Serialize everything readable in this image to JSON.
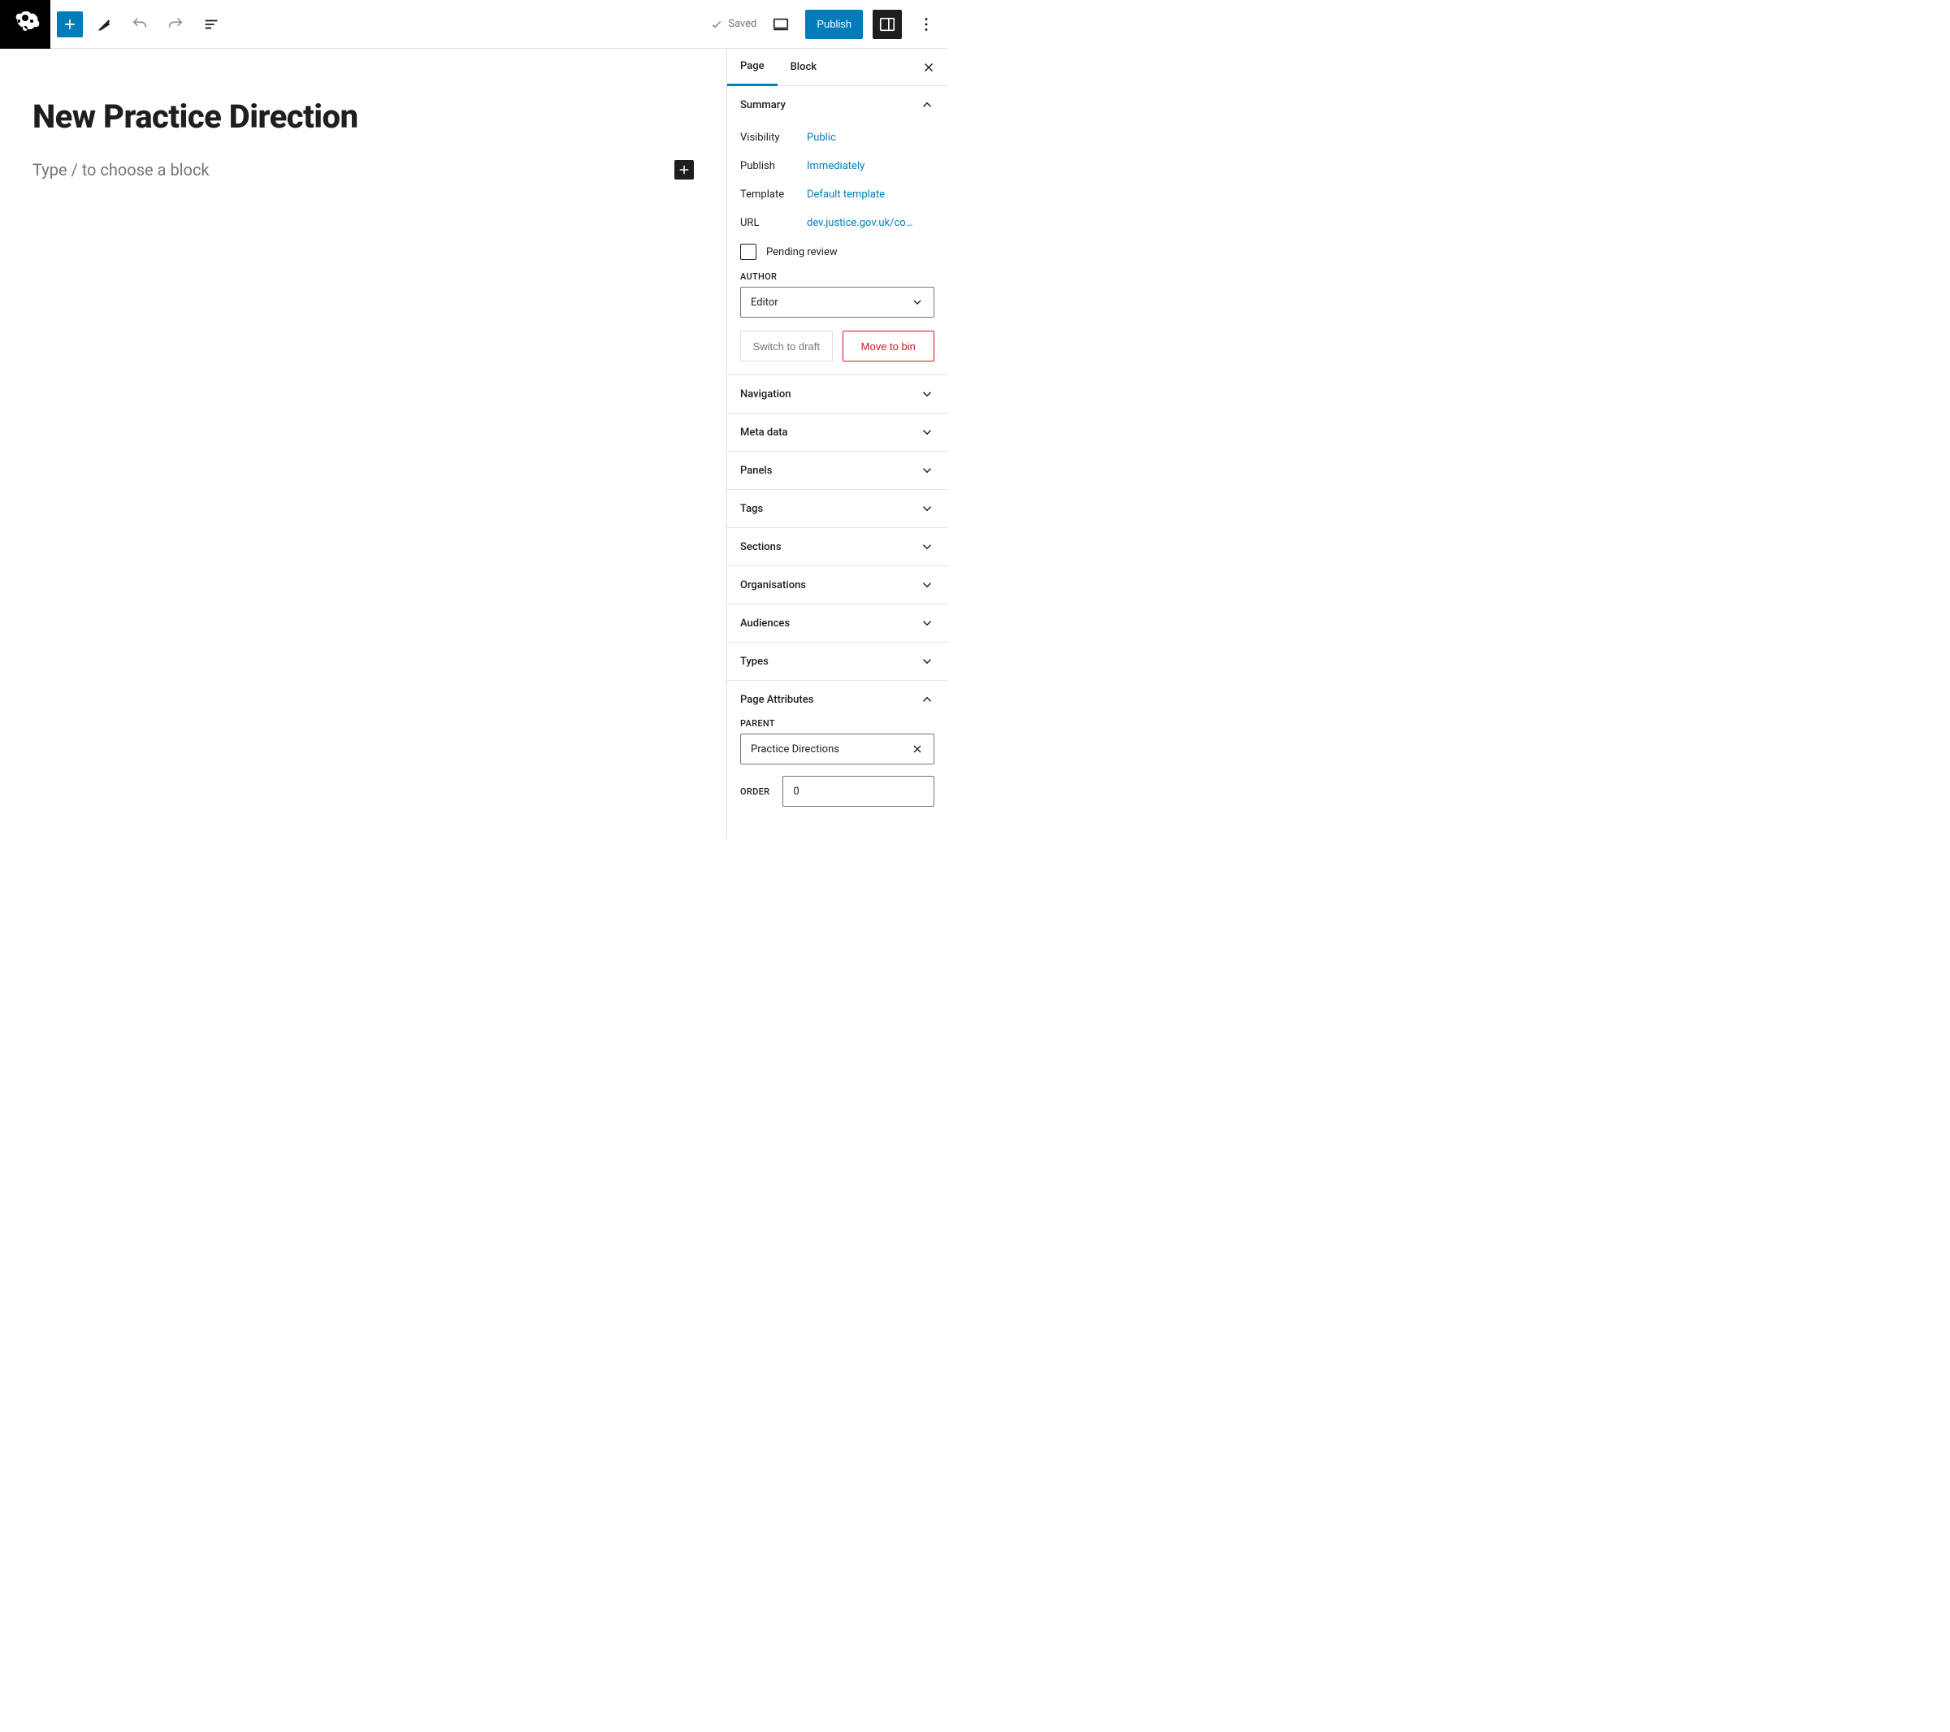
{
  "topbar": {
    "saved_label": "Saved",
    "publish_label": "Publish"
  },
  "editor": {
    "title": "New Practice Direction",
    "placeholder": "Type / to choose a block"
  },
  "sidebar": {
    "tabs": {
      "page": "Page",
      "block": "Block"
    },
    "summary": {
      "title": "Summary",
      "visibility_label": "Visibility",
      "visibility_value": "Public",
      "publish_label": "Publish",
      "publish_value": "Immediately",
      "template_label": "Template",
      "template_value": "Default template",
      "url_label": "URL",
      "url_value": "dev.justice.gov.uk/co…",
      "pending_review": "Pending review",
      "author_label": "AUTHOR",
      "author_value": "Editor",
      "switch_draft": "Switch to draft",
      "move_bin": "Move to bin"
    },
    "panels": {
      "navigation": "Navigation",
      "meta_data": "Meta data",
      "panels": "Panels",
      "tags": "Tags",
      "sections": "Sections",
      "organisations": "Organisations",
      "audiences": "Audiences",
      "types": "Types",
      "page_attributes": "Page Attributes"
    },
    "page_attributes": {
      "parent_label": "PARENT",
      "parent_value": "Practice Directions",
      "order_label": "ORDER",
      "order_value": "0"
    }
  }
}
